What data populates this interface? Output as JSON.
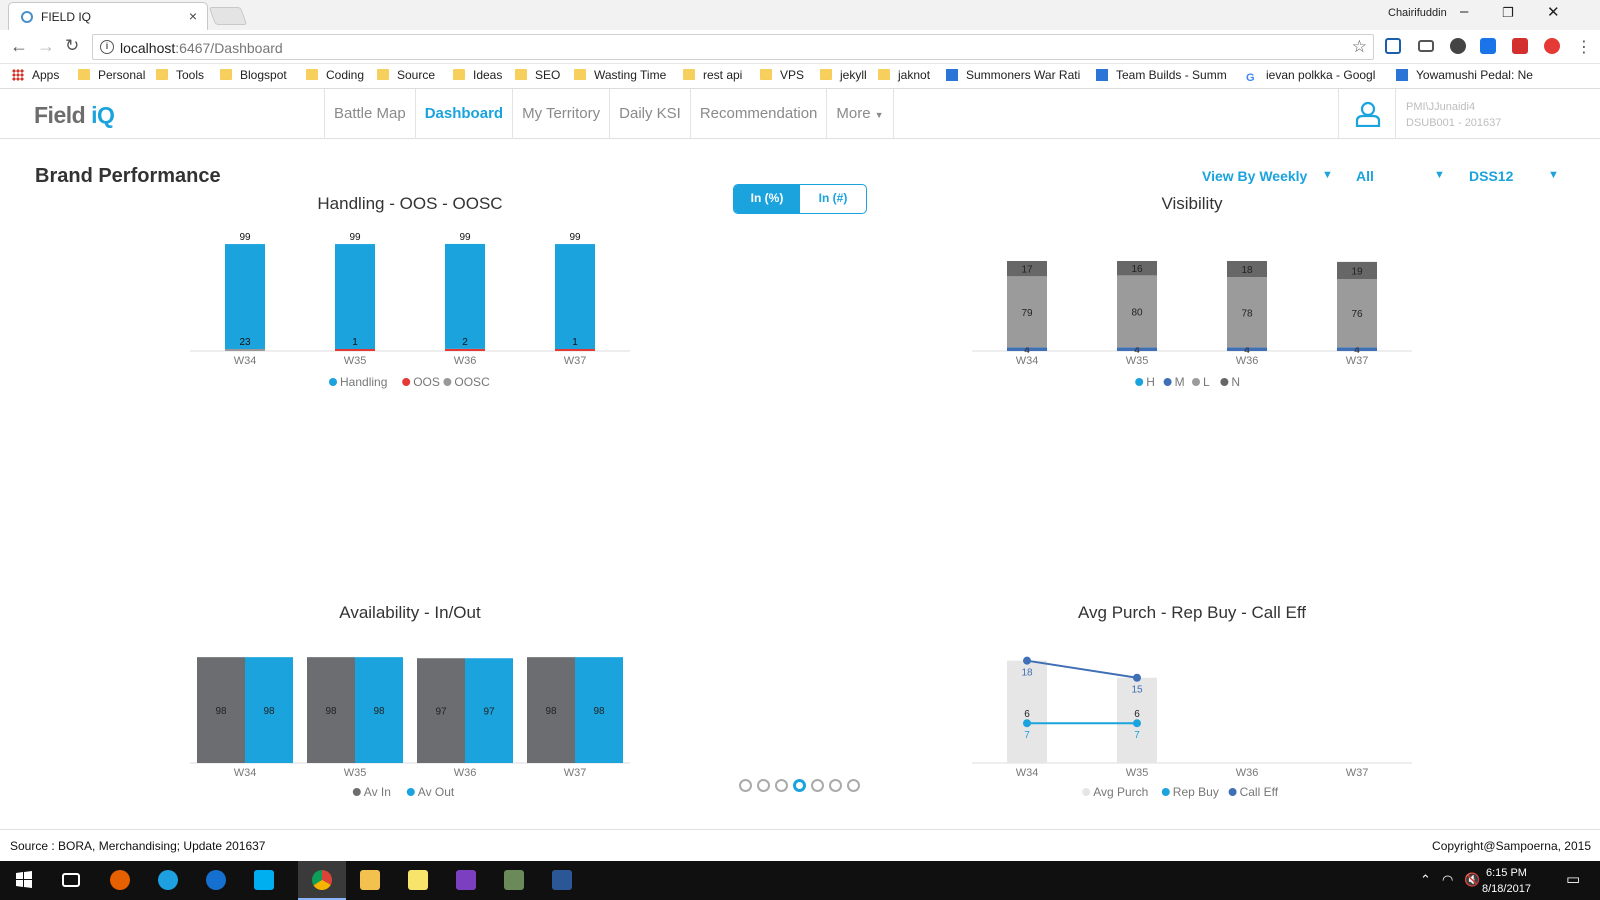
{
  "browser": {
    "tab_title": "FIELD IQ",
    "tab_close": "×",
    "user": "Chairifuddin",
    "url_host": "localhost",
    "url_port_path": ":6467/Dashboard",
    "bookmarks": [
      "Apps",
      "Personal",
      "Tools",
      "Blogspot",
      "Coding",
      "Source",
      "Ideas",
      "SEO",
      "Wasting Time",
      "rest api",
      "VPS",
      "jekyll",
      "jaknot",
      "Summoners War Rati",
      "Team Builds - Summ",
      "ievan polkka - Googl",
      "Yowamushi Pedal: Ne"
    ]
  },
  "app": {
    "logo_main": "Field ",
    "logo_accent": "iQ",
    "nav": [
      "Battle Map",
      "Dashboard",
      "My Territory",
      "Daily KSI",
      "Recommendation",
      "More"
    ],
    "active_nav": "Dashboard",
    "user_line1": "PMI\\JJunaidi4",
    "user_line2": "DSUB001 - 201637"
  },
  "page": {
    "title": "Brand Performance",
    "toggle": [
      "In (%)",
      "In (#)"
    ],
    "toggle_active": "In (%)",
    "filters": [
      "View By Weekly",
      "All",
      "DSS12"
    ]
  },
  "chart_data": [
    {
      "type": "bar",
      "title": "Handling - OOS - OOSC",
      "categories": [
        "W34",
        "W35",
        "W36",
        "W37"
      ],
      "stacked": true,
      "series": [
        {
          "name": "Handling",
          "values": [
            99,
            99,
            99,
            99
          ],
          "color": "#1ba3dd"
        },
        {
          "name": "OOS",
          "values": [
            0,
            1,
            2,
            1
          ],
          "color": "#e53935"
        },
        {
          "name": "OOSC",
          "values": [
            1,
            0,
            0,
            0
          ],
          "color": "#999999"
        }
      ],
      "data_labels": [
        [
          "99",
          "23"
        ],
        [
          "99",
          "1"
        ],
        [
          "99",
          "2"
        ],
        [
          "99",
          "1"
        ]
      ],
      "legend": "bottom"
    },
    {
      "type": "bar",
      "title": "Visibility",
      "categories": [
        "W34",
        "W35",
        "W36",
        "W37"
      ],
      "stacked": true,
      "series": [
        {
          "name": "H",
          "values": [
            0,
            0,
            0,
            0
          ],
          "color": "#1ba3dd"
        },
        {
          "name": "M",
          "values": [
            4,
            4,
            4,
            4
          ],
          "color": "#3f6fb5"
        },
        {
          "name": "L",
          "values": [
            79,
            80,
            78,
            76
          ],
          "color": "#9b9b9b"
        },
        {
          "name": "N",
          "values": [
            17,
            16,
            18,
            19
          ],
          "color": "#676767"
        }
      ],
      "legend": "bottom"
    },
    {
      "type": "bar",
      "title": "Availability - In/Out",
      "categories": [
        "W34",
        "W35",
        "W36",
        "W37"
      ],
      "series": [
        {
          "name": "Av In",
          "values": [
            98,
            98,
            97,
            98
          ],
          "color": "#6b6d70"
        },
        {
          "name": "Av Out",
          "values": [
            98,
            98,
            97,
            98
          ],
          "color": "#1ba3dd"
        }
      ],
      "legend": "bottom"
    },
    {
      "type": "line",
      "title": "Avg Purch - Rep Buy - Call Eff",
      "categories": [
        "W34",
        "W35",
        "W36",
        "W37"
      ],
      "series": [
        {
          "name": "Avg Purch",
          "type": "bar",
          "values": [
            18,
            15,
            null,
            null
          ],
          "color": "#e6e6e6"
        },
        {
          "name": "Rep Buy",
          "values": [
            7,
            7,
            null,
            null
          ],
          "color": "#1ba3dd"
        },
        {
          "name": "Call Eff",
          "values": [
            18,
            15,
            null,
            null
          ],
          "color": "#3f6fb5"
        }
      ],
      "extra_labels": [
        [
          "6",
          "7"
        ],
        [
          "6",
          "7"
        ]
      ],
      "legend": "bottom"
    }
  ],
  "carousel": {
    "count": 7,
    "active": 3
  },
  "footer": {
    "source": "Source : BORA, Merchandising; Update 201637",
    "copyright": "Copyright@Sampoerna, 2015"
  },
  "taskbar": {
    "time": "6:15 PM",
    "date": "8/18/2017"
  }
}
